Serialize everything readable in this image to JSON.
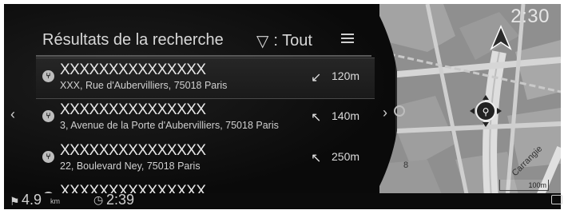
{
  "clock": "2:30",
  "header": {
    "title": "Résultats de la recherche",
    "filter_label": ": Tout"
  },
  "results": [
    {
      "name": "XXXXXXXXXXXXXXX",
      "address": "XXX, Rue d'Aubervilliers, 75018 Paris",
      "distance": "120m",
      "direction_icon": "arrow-down-left",
      "category_icon": "restaurant-icon"
    },
    {
      "name": "XXXXXXXXXXXXXXX",
      "address": "3, Avenue de la Porte d'Aubervilliers, 75018 Paris",
      "distance": "140m",
      "direction_icon": "arrow-up-left",
      "category_icon": "restaurant-icon"
    },
    {
      "name": "XXXXXXXXXXXXXXX",
      "address": "22, Boulevard Ney, 75018 Paris",
      "distance": "250m",
      "direction_icon": "arrow-left",
      "category_icon": "restaurant-icon"
    },
    {
      "name": "XXXXXXXXXXXXXXX",
      "address": "",
      "distance": "",
      "direction_icon": "arrow-left",
      "category_icon": "restaurant-icon"
    }
  ],
  "map": {
    "scale_label": "100m",
    "street_label": "Carrangie"
  },
  "status_bar": {
    "distance_value": "4.9",
    "distance_unit": "km",
    "time_value": "2:39"
  },
  "colors": {
    "background": "#0b0b0b",
    "text": "#e0e0e0",
    "map_block": "#9a9a9a",
    "map_road": "#d8d8d8"
  }
}
